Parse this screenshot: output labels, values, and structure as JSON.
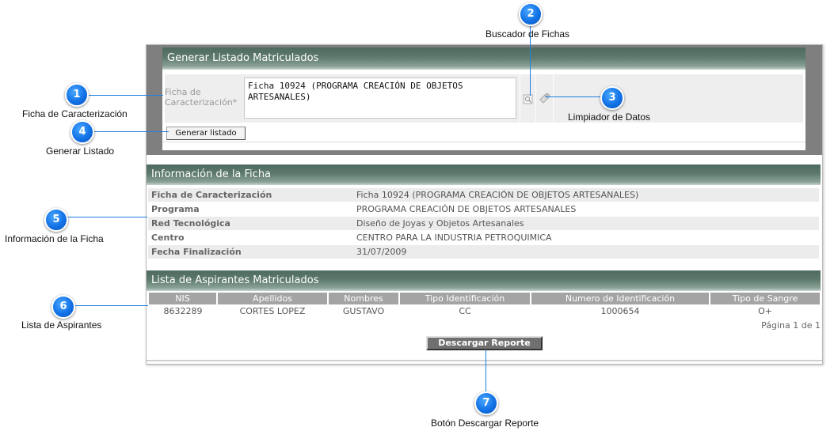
{
  "generar": {
    "header": "Generar Listado Matriculados",
    "ficha_label": "Ficha de Caracterización*",
    "ficha_value": "Ficha 10924 (PROGRAMA CREACIÓN DE OBJETOS ARTESANALES)",
    "button_label": "Generar listado"
  },
  "info": {
    "header": "Información de la Ficha",
    "rows": [
      {
        "label": "Ficha de Caracterización",
        "value": "Ficha 10924 (PROGRAMA CREACIÓN DE OBJETOS ARTESANALES)"
      },
      {
        "label": "Programa",
        "value": "PROGRAMA CREACIÓN DE OBJETOS ARTESANALES"
      },
      {
        "label": "Red Tecnológica",
        "value": "Diseño de Joyas y Objetos Artesanales"
      },
      {
        "label": "Centro",
        "value": "CENTRO PARA LA INDUSTRIA PETROQUIMICA"
      },
      {
        "label": "Fecha Finalización",
        "value": "31/07/2009"
      }
    ]
  },
  "list": {
    "header": "Lista de Aspirantes Matriculados",
    "columns": [
      "NIS",
      "Apellidos",
      "Nombres",
      "Tipo Identificación",
      "Numero de Identificación",
      "Tipo de Sangre"
    ],
    "rows": [
      [
        "8632289",
        "CORTES LOPEZ",
        "GUSTAVO",
        "CC",
        "1000654",
        "O+"
      ]
    ],
    "pagination": "Página 1 de 1",
    "download_label": "Descargar Reporte"
  },
  "callouts": [
    {
      "number": "1",
      "label": "Ficha de Caracterización"
    },
    {
      "number": "2",
      "label": "Buscador de Fichas"
    },
    {
      "number": "3",
      "label": "Limpiador de Datos"
    },
    {
      "number": "4",
      "label": "Generar Listado"
    },
    {
      "number": "5",
      "label": "Información de la Ficha"
    },
    {
      "number": "6",
      "label": "Lista de Aspirantes"
    },
    {
      "number": "7",
      "label": "Botón Descargar Reporte"
    }
  ],
  "colors": {
    "header_green": "#5d7a6d",
    "panel_gray": "#7f7f7f",
    "callout_blue": "#1272e6"
  },
  "icons": {
    "search": "search-icon",
    "clear": "eraser-icon"
  }
}
